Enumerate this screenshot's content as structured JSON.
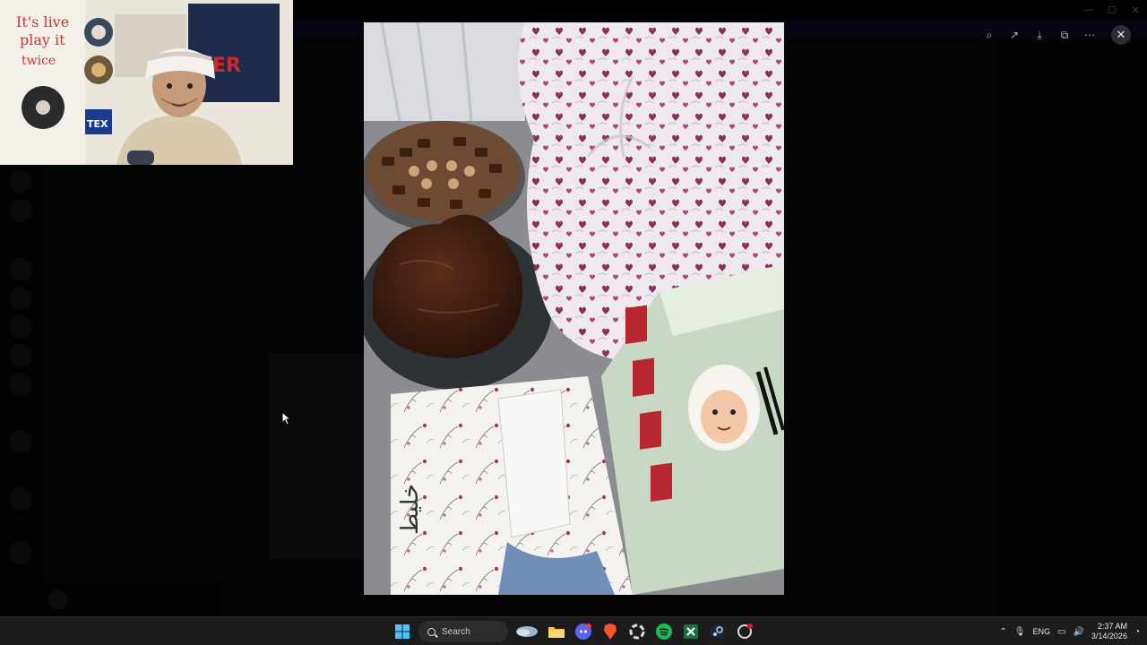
{
  "window": {
    "title": "",
    "controls": {
      "minimize": "—",
      "maximize": "☐",
      "close": "✕"
    }
  },
  "viewer": {
    "tools": [
      {
        "name": "zoom-icon",
        "glyph": "⌕"
      },
      {
        "name": "forward-icon",
        "glyph": "↗"
      },
      {
        "name": "download-icon",
        "glyph": "⤓"
      },
      {
        "name": "open-external-icon",
        "glyph": "⧉"
      },
      {
        "name": "more-icon",
        "glyph": "⋯"
      }
    ],
    "close_glyph": "✕"
  },
  "taskbar": {
    "search_label": "Search",
    "apps": [
      {
        "name": "file-explorer-icon",
        "color": "#f2c14e"
      },
      {
        "name": "discord-icon",
        "color": "#5865f2"
      },
      {
        "name": "brave-icon",
        "color": "#fb542b"
      },
      {
        "name": "davinci-icon",
        "color": "#c9c9c9"
      },
      {
        "name": "spotify-icon",
        "color": "#1db954"
      },
      {
        "name": "excel-icon",
        "color": "#1d6f42"
      },
      {
        "name": "steam-icon",
        "color": "#9ab0c8"
      },
      {
        "name": "app-icon",
        "color": "#d8d8d8"
      }
    ],
    "tray": {
      "language": "ENG",
      "time": "2:37 AM",
      "date": "3/14/2026"
    }
  },
  "colors": {
    "accent": "#5865f2",
    "taskbar_bg": "#1c1c1c",
    "overlay_bg": "#000000"
  }
}
